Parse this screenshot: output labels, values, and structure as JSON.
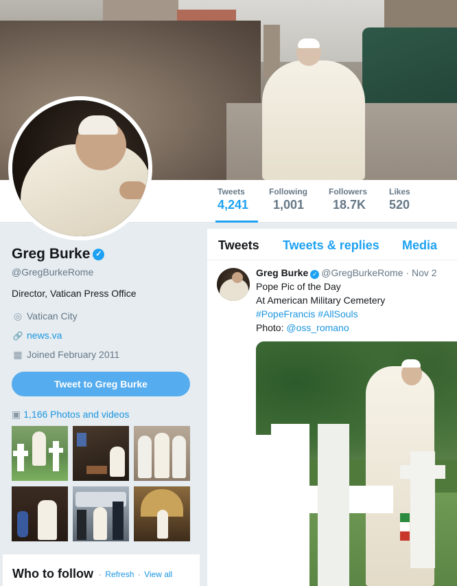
{
  "profile": {
    "name": "Greg Burke",
    "handle": "@GregBurkeRome",
    "bio": "Director, Vatican Press Office",
    "location": "Vatican City",
    "website": "news.va",
    "joined": "Joined February 2011",
    "tweet_button": "Tweet to Greg Burke",
    "photos_link": "1,166 Photos and videos"
  },
  "stats": [
    {
      "label": "Tweets",
      "value": "4,241"
    },
    {
      "label": "Following",
      "value": "1,001"
    },
    {
      "label": "Followers",
      "value": "18.7K"
    },
    {
      "label": "Likes",
      "value": "520"
    }
  ],
  "who_to_follow": {
    "title": "Who to follow",
    "refresh": "Refresh",
    "view_all": "View all"
  },
  "tabs": [
    "Tweets",
    "Tweets & replies",
    "Media"
  ],
  "tweet": {
    "name": "Greg Burke",
    "handle": "@GregBurkeRome",
    "date": "· Nov 2",
    "line1": "Pope Pic of the Day",
    "line2": "At American Military Cemetery",
    "hashtag1": "#PopeFrancis",
    "hashtag2": "#AllSouls",
    "photo_prefix": "Photo: ",
    "photo_credit": "@oss_romano"
  },
  "icons": {
    "verified": "✓",
    "location": "◎",
    "link": "🔗",
    "calendar": "▦",
    "photos": "▣"
  },
  "colors": {
    "accent": "#1da1f2",
    "button": "#55acee",
    "background": "#e6ecf0"
  }
}
